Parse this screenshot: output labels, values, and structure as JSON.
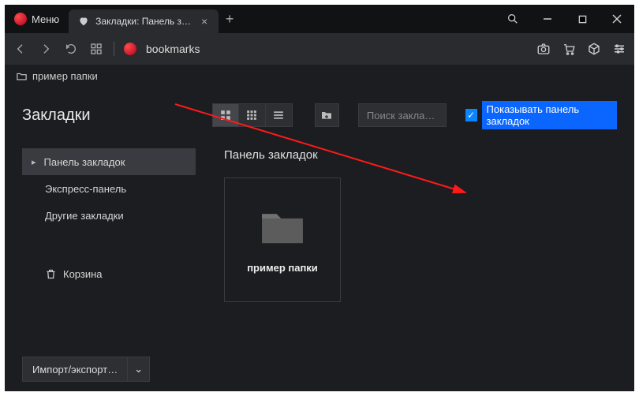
{
  "titlebar": {
    "menu_label": "Меню",
    "tab_title": "Закладки: Панель закладок",
    "tab_close": "×",
    "new_tab": "+"
  },
  "addressbar": {
    "url_text": "bookmarks"
  },
  "bookmarkbar": {
    "folder_name": "пример папки"
  },
  "page": {
    "title": "Закладки",
    "search_placeholder": "Поиск закла…",
    "checkbox_label": "Показывать панель закладок"
  },
  "sidebar": {
    "items": [
      {
        "label": "Панель закладок",
        "active": true
      },
      {
        "label": "Экспресс-панель",
        "active": false
      },
      {
        "label": "Другие закладки",
        "active": false
      }
    ],
    "trash_label": "Корзина"
  },
  "main": {
    "section_title": "Панель закладок",
    "folder_name": "пример папки"
  },
  "footer": {
    "import_label": "Импорт/экспорт…",
    "caret": "⌄"
  }
}
